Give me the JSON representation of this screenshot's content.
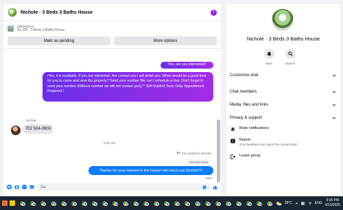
{
  "chat": {
    "title": "Nichole · 3 Beds 3 Baths House",
    "info_icon": "info-icon",
    "marketplace_label": "Marketplace",
    "listing_price": "$1,320 · 3 Beds 3 Baths House",
    "mark_pending_label": "Mark as pending",
    "more_options_label": "More options",
    "messages": {
      "out1": "Yes, are you interested?",
      "out2": "/Yes, it is available. If you are interested.  Am contact you i will detail you.  When would be a good time for you to come and view the property? Send your numbar We can I schedule a tour.  Don't forget to send your number (Without number we will not contact you),** Self-Guided Tours Only. Appointment Required /",
      "sender_name": "Nichole",
      "in1": "702 504-0903",
      "timestamp": "9:25 PM",
      "replied_to": "You replied to Nichole",
      "quoted": "702 504-0903",
      "out3": "Thanks for your interest in the house! will reach out Shortly!!!!!",
      "sent_status": "Sent"
    },
    "compose_placeholder": "Aa"
  },
  "sidebar": {
    "name": "Nichole · 3 Beds 3 Baths House",
    "mute_label": "Mute",
    "search_label": "Search",
    "sections": [
      "Customize chat",
      "Chat members",
      "Media, files and links",
      "Privacy & support"
    ],
    "mute_notifications": "Mute notifications",
    "report_title": "Report",
    "report_desc": "Give feedback and report the conversation",
    "leave_group": "Leave group"
  },
  "taskbar": {
    "temperature": "28°C",
    "language": "ENG",
    "time": "9:25 PM",
    "date": "4/13/2025"
  },
  "colors": {
    "accent_purple": "#8a2be2",
    "messenger_blue": "#0a7cff",
    "taskbar": "#1a2633"
  }
}
